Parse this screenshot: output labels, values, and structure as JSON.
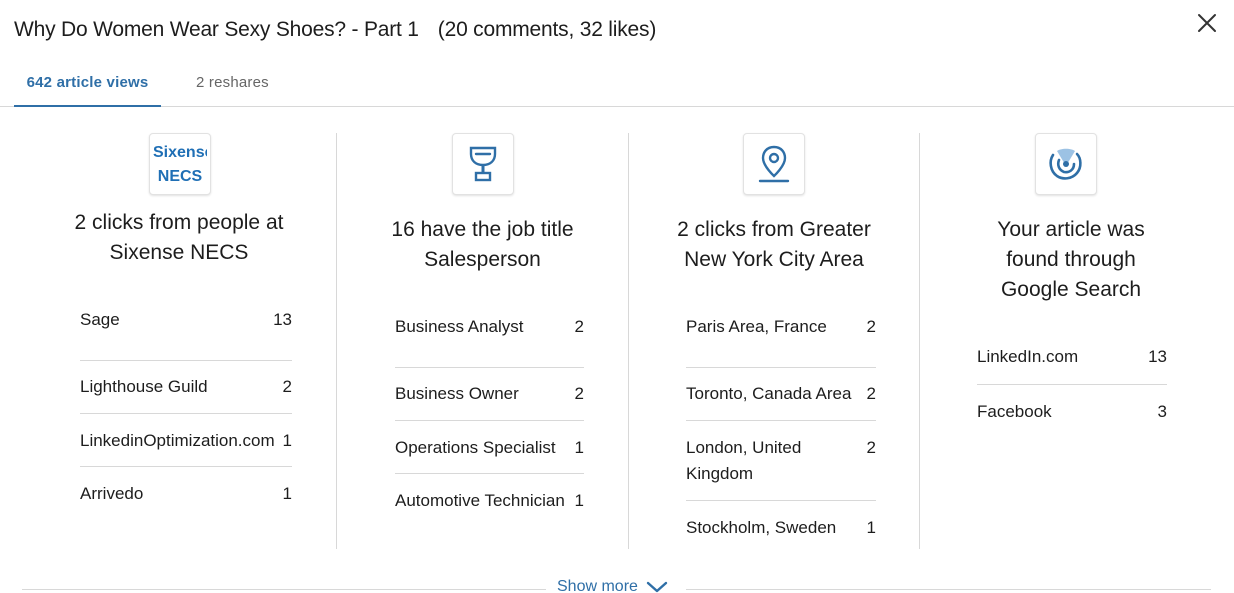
{
  "header": {
    "title": "Why Do Women Wear Sexy Shoes? - Part 1",
    "counts": "(20 comments, 32 likes)"
  },
  "tabs": [
    {
      "label": "642 article views",
      "active": true
    },
    {
      "label": "2 reshares",
      "active": false
    }
  ],
  "columns": [
    {
      "icon": "company-logo",
      "logo_text": "Sixense NECS",
      "headline": "2 clicks from people at Sixense NECS",
      "rows": [
        {
          "name": "Sage",
          "value": "13"
        },
        {
          "name": "Lighthouse Guild",
          "value": "2"
        },
        {
          "name": "LinkedinOptimization.com",
          "value": "1"
        },
        {
          "name": "Arrivedo",
          "value": "1"
        }
      ]
    },
    {
      "icon": "trophy-icon",
      "headline": "16 have the job title Salesperson",
      "rows": [
        {
          "name": "Business Analyst",
          "value": "2"
        },
        {
          "name": "Business Owner",
          "value": "2"
        },
        {
          "name": "Operations Specialist",
          "value": "1"
        },
        {
          "name": "Automotive Technician",
          "value": "1"
        }
      ]
    },
    {
      "icon": "location-pin-icon",
      "headline": "2 clicks from Greater New York City Area",
      "rows": [
        {
          "name": "Paris Area, France",
          "value": "2"
        },
        {
          "name": "Toronto, Canada Area",
          "value": "2"
        },
        {
          "name": "London, United Kingdom",
          "value": "2"
        },
        {
          "name": "Stockholm, Sweden",
          "value": "1"
        }
      ]
    },
    {
      "icon": "signal-icon",
      "headline": "Your article was found through Google Search",
      "rows": [
        {
          "name": "LinkedIn.com",
          "value": "13"
        },
        {
          "name": "Facebook",
          "value": "3"
        }
      ]
    }
  ],
  "footer": {
    "show_more": "Show more"
  },
  "colors": {
    "accent": "#2f6fa7",
    "divider": "#d8d8d8",
    "icon_blue": "#2f6fa7"
  }
}
